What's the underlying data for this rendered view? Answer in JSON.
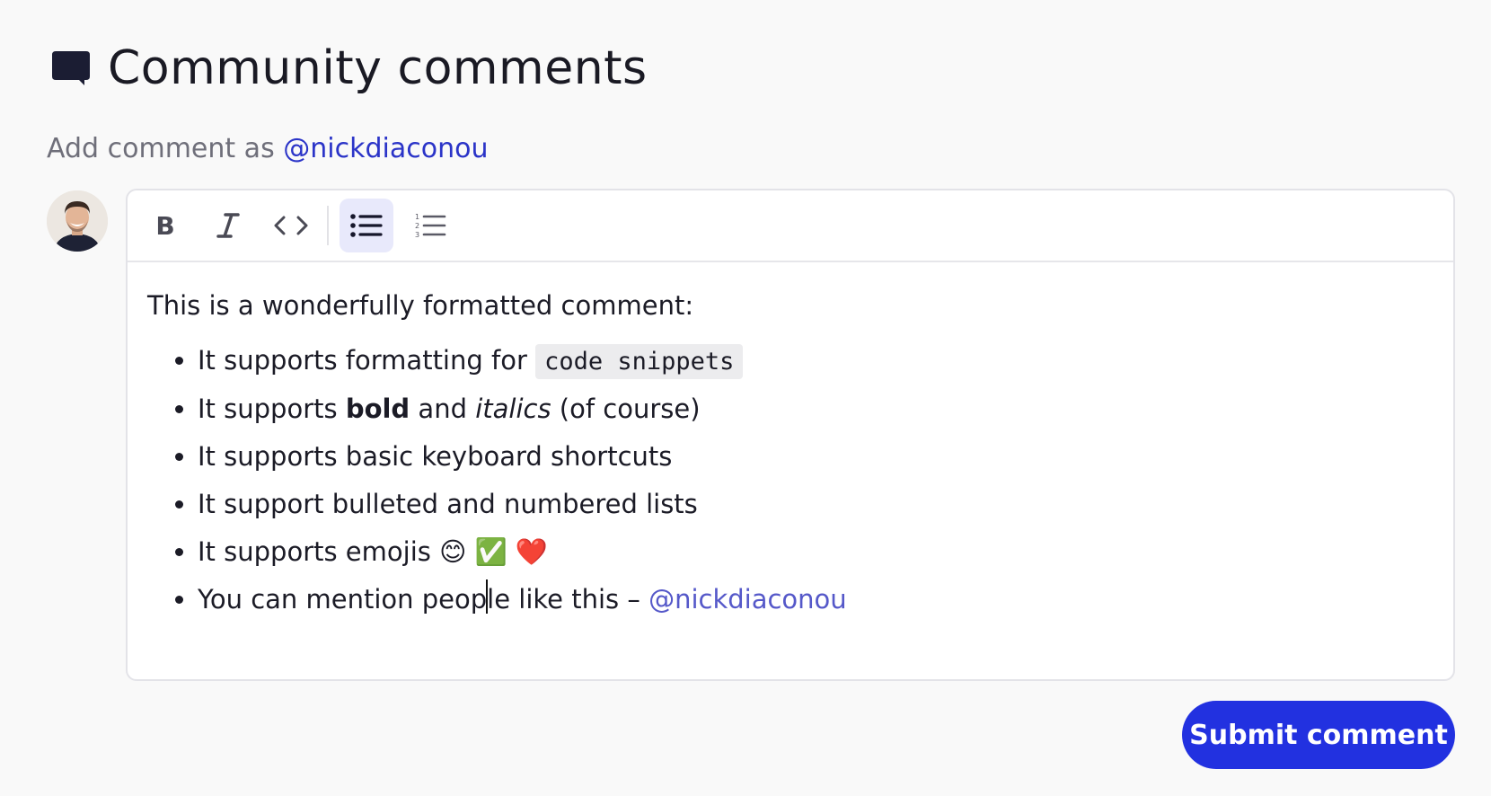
{
  "header": {
    "icon": "speech-bubble-icon",
    "title": "Community comments"
  },
  "add_as": {
    "prefix": "Add comment as",
    "handle": "@nickdiaconou"
  },
  "toolbar": {
    "buttons": [
      {
        "name": "bold",
        "icon": "bold-icon",
        "active": false
      },
      {
        "name": "italic",
        "icon": "italic-icon",
        "active": false
      },
      {
        "name": "code",
        "icon": "code-icon",
        "active": false
      },
      {
        "name": "bulleted-list",
        "icon": "bulleted-list-icon",
        "active": true
      },
      {
        "name": "numbered-list",
        "icon": "numbered-list-icon",
        "active": false
      }
    ]
  },
  "editor": {
    "intro": "This is a wonderfully formatted comment:",
    "items": [
      {
        "text": "It supports formatting for",
        "code": "code snippets"
      },
      {
        "pre": "It supports",
        "bold": "bold",
        "mid": "and",
        "italic": "italics",
        "post": "(of course)"
      },
      {
        "text": "It supports basic keyboard shortcuts"
      },
      {
        "text": "It support bulleted and numbered lists"
      },
      {
        "text": "It supports emojis",
        "emojis": "😊 ✅ ❤️"
      },
      {
        "text_before_caret": "You can mention peop",
        "text_after_caret": "le like this –",
        "mention": "@nickdiaconou"
      }
    ]
  },
  "submit": {
    "label": "Submit comment"
  },
  "colors": {
    "accent": "#2231e0",
    "mention": "#5558c9",
    "handle": "#2b34c8",
    "active_tool_bg": "#e8e9fb"
  }
}
